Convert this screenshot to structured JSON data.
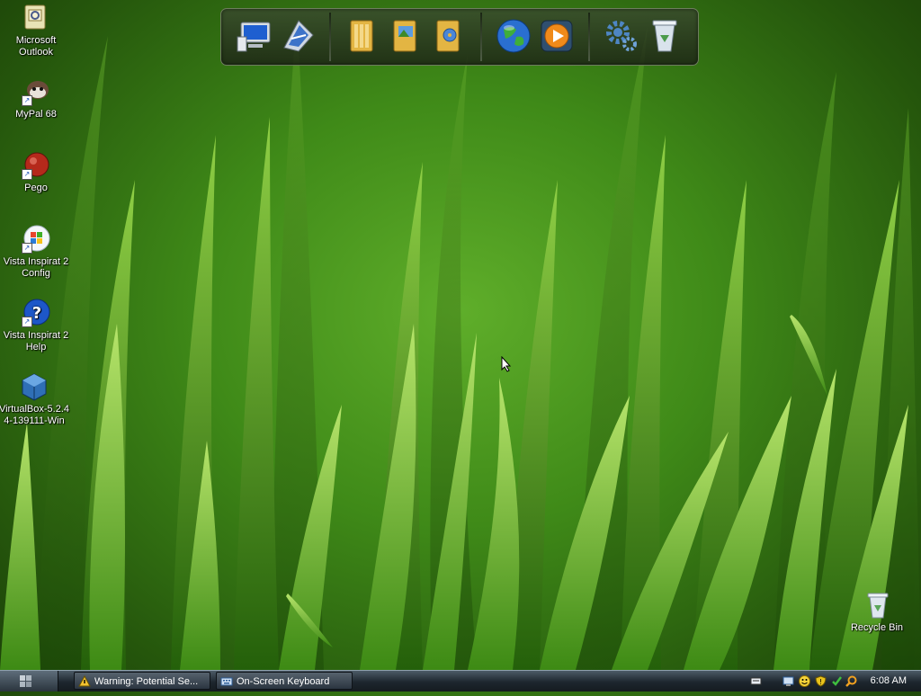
{
  "desktop": {
    "icons": [
      {
        "label": "Microsoft Outlook",
        "icon": "outlook-icon"
      },
      {
        "label": "MyPal 68",
        "icon": "mypal-icon"
      },
      {
        "label": "Pego",
        "icon": "pego-icon"
      },
      {
        "label": "Vista Inspirat 2 Config",
        "icon": "windows-logo-icon"
      },
      {
        "label": "Vista Inspirat 2 Help",
        "icon": "help-icon"
      },
      {
        "label": "VirtualBox-5.2.44-139111-Win",
        "icon": "virtualbox-icon"
      },
      {
        "label": "Recycle Bin",
        "icon": "recycle-bin-icon"
      }
    ]
  },
  "dock": {
    "items": [
      "my-computer-icon",
      "network-icon",
      "documents-icon",
      "pictures-icon",
      "music-icon",
      "internet-globe-icon",
      "media-player-icon",
      "settings-gears-icon",
      "recycle-bin-icon"
    ]
  },
  "taskbar": {
    "tasks": [
      {
        "label": "Warning: Potential Se...",
        "icon": "warning-icon"
      },
      {
        "label": "On-Screen Keyboard",
        "icon": "keyboard-icon"
      }
    ],
    "tray_icons": [
      "keyboard-icon",
      "network-monitor-icon",
      "smiley-icon",
      "security-shield-icon",
      "checkmark-icon",
      "search-icon"
    ],
    "clock": "6:08 AM"
  }
}
